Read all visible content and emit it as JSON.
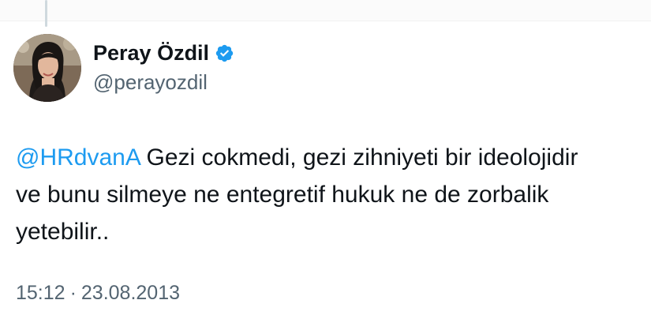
{
  "author": {
    "display_name": "Peray Özdil",
    "handle": "@perayozdil",
    "verified_icon": "verified-badge-icon",
    "verified_color": "#1d9bf0"
  },
  "tweet": {
    "mention": "@HRdvanA",
    "text_line_1": " Gezi cokmedi, gezi zihniyeti bir ideolojidir",
    "text_line_2": "ve bunu silmeye ne entegretif hukuk ne de zorbalik",
    "text_line_3": "yetebilir.."
  },
  "meta": {
    "time": "15:12",
    "separator": "·",
    "date": "23.08.2013"
  },
  "colors": {
    "text": "#0f1419",
    "secondary": "#536471",
    "link": "#1d9bf0"
  }
}
